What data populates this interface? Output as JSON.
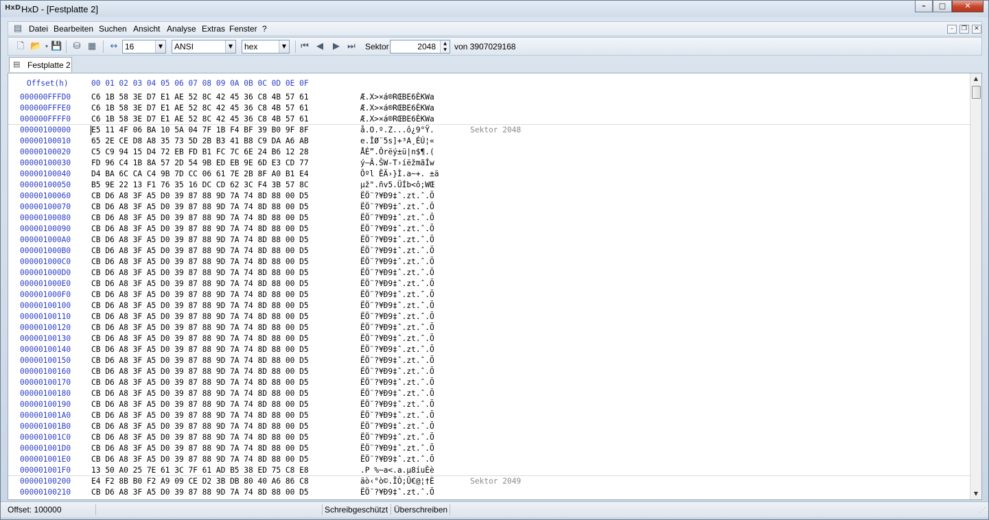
{
  "window": {
    "app_icon": "HxD",
    "title": "HxD - [Festplatte 2]",
    "caption": {
      "minimize": "–",
      "maximize": "□",
      "close": "✕"
    }
  },
  "menu": {
    "items": [
      "Datei",
      "Bearbeiten",
      "Suchen",
      "Ansicht",
      "Analyse",
      "Extras",
      "Fenster",
      "?"
    ],
    "mdi": {
      "minimize": "–",
      "restore": "❐",
      "close": "✕"
    }
  },
  "toolbar": {
    "icons": {
      "new": "new-file-icon",
      "open": "open-folder-icon",
      "save": "save-disk-icon",
      "disk": "open-disk-icon",
      "ram": "open-ram-icon",
      "bytes_per_row": "bytes-per-row-icon"
    },
    "bytes_per_row": "16",
    "charset": "ANSI",
    "offset_base": "hex",
    "sector_label": "Sektor",
    "sector_value": "2048",
    "sector_total": "von 3907029168"
  },
  "tab": {
    "label": "Festplatte 2"
  },
  "editor": {
    "header_offset": "Offset(h)",
    "header_hex": "00 01 02 03 04 05 06 07 08 09 0A 0B 0C 0D 0E 0F",
    "rows": [
      {
        "offset": "000000FFFD0",
        "hex": "C6 1B 58 3E D7 E1 AE 52 8C 42 45 36 C8 4B 57 61",
        "ascii": "Æ.X>×á®RŒBE6ÈKWa",
        "sector": ""
      },
      {
        "offset": "000000FFFE0",
        "hex": "C6 1B 58 3E D7 E1 AE 52 8C 42 45 36 C8 4B 57 61",
        "ascii": "Æ.X>×á®RŒBE6ÈKWa",
        "sector": ""
      },
      {
        "offset": "000000FFFF0",
        "hex": "C6 1B 58 3E D7 E1 AE 52 8C 42 45 36 C8 4B 57 61",
        "ascii": "Æ.X>×á®RŒBE6ÈKWa",
        "sector": ""
      },
      {
        "offset": "00000100000",
        "hex": "E5 11 4F 06 BA 10 5A 04 7F 1B F4 BF 39 B0 9F 8F",
        "ascii": "å.O.º.Z...ô¿9°Ÿ.",
        "sector": "Sektor 2048"
      },
      {
        "offset": "00000100010",
        "hex": "65 2E CE D8 A8 35 73 5D 2B B3 41 B8 C9 DA A6 AB",
        "ascii": "e.ÎØ¨5s]+³A¸ÉÚ¦«",
        "sector": ""
      },
      {
        "offset": "00000100020",
        "hex": "C5 C9 94 15 D4 72 EB FD B1 FC 7C 6E 24 B6 12 28",
        "ascii": "ÅÉ”.Ôrëý±ü|n$¶.(",
        "sector": ""
      },
      {
        "offset": "00000100030",
        "hex": "FD 96 C4 1B 8A 57 2D 54 9B ED EB 9E 6D E3 CD 77",
        "ascii": "ý–Ä.ŠW-T›íëžmãÍw",
        "sector": ""
      },
      {
        "offset": "00000100040",
        "hex": "D4 BA 6C CA C4 9B 7D CC 06 61 7E 2B 8F A0 B1 E4",
        "ascii": "Ôºl ÊÄ›}Ì.a~+. ±ä",
        "sector": ""
      },
      {
        "offset": "00000100050",
        "hex": "B5 9E 22 13 F1 76 35 16 DC CD 62 3C F4 3B 57 8C",
        "ascii": "µž\".ñv5.ÜÍb<ô;WŒ",
        "sector": ""
      },
      {
        "offset": "00000100060",
        "hex": "CB D6 A8 3F A5 D0 39 87 88 9D 7A 74 8D 88 00 D5",
        "ascii": "ËÖ¨?¥Ð9‡ˆ.zt.ˆ.Õ",
        "sector": ""
      },
      {
        "offset": "00000100070",
        "hex": "CB D6 A8 3F A5 D0 39 87 88 9D 7A 74 8D 88 00 D5",
        "ascii": "ËÖ¨?¥Ð9‡ˆ.zt.ˆ.Õ",
        "sector": ""
      },
      {
        "offset": "00000100080",
        "hex": "CB D6 A8 3F A5 D0 39 87 88 9D 7A 74 8D 88 00 D5",
        "ascii": "ËÖ¨?¥Ð9‡ˆ.zt.ˆ.Õ",
        "sector": ""
      },
      {
        "offset": "00000100090",
        "hex": "CB D6 A8 3F A5 D0 39 87 88 9D 7A 74 8D 88 00 D5",
        "ascii": "ËÖ¨?¥Ð9‡ˆ.zt.ˆ.Õ",
        "sector": ""
      },
      {
        "offset": "000001000A0",
        "hex": "CB D6 A8 3F A5 D0 39 87 88 9D 7A 74 8D 88 00 D5",
        "ascii": "ËÖ¨?¥Ð9‡ˆ.zt.ˆ.Õ",
        "sector": ""
      },
      {
        "offset": "000001000B0",
        "hex": "CB D6 A8 3F A5 D0 39 87 88 9D 7A 74 8D 88 00 D5",
        "ascii": "ËÖ¨?¥Ð9‡ˆ.zt.ˆ.Õ",
        "sector": ""
      },
      {
        "offset": "000001000C0",
        "hex": "CB D6 A8 3F A5 D0 39 87 88 9D 7A 74 8D 88 00 D5",
        "ascii": "ËÖ¨?¥Ð9‡ˆ.zt.ˆ.Õ",
        "sector": ""
      },
      {
        "offset": "000001000D0",
        "hex": "CB D6 A8 3F A5 D0 39 87 88 9D 7A 74 8D 88 00 D5",
        "ascii": "ËÖ¨?¥Ð9‡ˆ.zt.ˆ.Õ",
        "sector": ""
      },
      {
        "offset": "000001000E0",
        "hex": "CB D6 A8 3F A5 D0 39 87 88 9D 7A 74 8D 88 00 D5",
        "ascii": "ËÖ¨?¥Ð9‡ˆ.zt.ˆ.Õ",
        "sector": ""
      },
      {
        "offset": "000001000F0",
        "hex": "CB D6 A8 3F A5 D0 39 87 88 9D 7A 74 8D 88 00 D5",
        "ascii": "ËÖ¨?¥Ð9‡ˆ.zt.ˆ.Õ",
        "sector": ""
      },
      {
        "offset": "00000100100",
        "hex": "CB D6 A8 3F A5 D0 39 87 88 9D 7A 74 8D 88 00 D5",
        "ascii": "ËÖ¨?¥Ð9‡ˆ.zt.ˆ.Õ",
        "sector": ""
      },
      {
        "offset": "00000100110",
        "hex": "CB D6 A8 3F A5 D0 39 87 88 9D 7A 74 8D 88 00 D5",
        "ascii": "ËÖ¨?¥Ð9‡ˆ.zt.ˆ.Õ",
        "sector": ""
      },
      {
        "offset": "00000100120",
        "hex": "CB D6 A8 3F A5 D0 39 87 88 9D 7A 74 8D 88 00 D5",
        "ascii": "ËÖ¨?¥Ð9‡ˆ.zt.ˆ.Õ",
        "sector": ""
      },
      {
        "offset": "00000100130",
        "hex": "CB D6 A8 3F A5 D0 39 87 88 9D 7A 74 8D 88 00 D5",
        "ascii": "ËÖ¨?¥Ð9‡ˆ.zt.ˆ.Õ",
        "sector": ""
      },
      {
        "offset": "00000100140",
        "hex": "CB D6 A8 3F A5 D0 39 87 88 9D 7A 74 8D 88 00 D5",
        "ascii": "ËÖ¨?¥Ð9‡ˆ.zt.ˆ.Õ",
        "sector": ""
      },
      {
        "offset": "00000100150",
        "hex": "CB D6 A8 3F A5 D0 39 87 88 9D 7A 74 8D 88 00 D5",
        "ascii": "ËÖ¨?¥Ð9‡ˆ.zt.ˆ.Õ",
        "sector": ""
      },
      {
        "offset": "00000100160",
        "hex": "CB D6 A8 3F A5 D0 39 87 88 9D 7A 74 8D 88 00 D5",
        "ascii": "ËÖ¨?¥Ð9‡ˆ.zt.ˆ.Õ",
        "sector": ""
      },
      {
        "offset": "00000100170",
        "hex": "CB D6 A8 3F A5 D0 39 87 88 9D 7A 74 8D 88 00 D5",
        "ascii": "ËÖ¨?¥Ð9‡ˆ.zt.ˆ.Õ",
        "sector": ""
      },
      {
        "offset": "00000100180",
        "hex": "CB D6 A8 3F A5 D0 39 87 88 9D 7A 74 8D 88 00 D5",
        "ascii": "ËÖ¨?¥Ð9‡ˆ.zt.ˆ.Õ",
        "sector": ""
      },
      {
        "offset": "00000100190",
        "hex": "CB D6 A8 3F A5 D0 39 87 88 9D 7A 74 8D 88 00 D5",
        "ascii": "ËÖ¨?¥Ð9‡ˆ.zt.ˆ.Õ",
        "sector": ""
      },
      {
        "offset": "000001001A0",
        "hex": "CB D6 A8 3F A5 D0 39 87 88 9D 7A 74 8D 88 00 D5",
        "ascii": "ËÖ¨?¥Ð9‡ˆ.zt.ˆ.Õ",
        "sector": ""
      },
      {
        "offset": "000001001B0",
        "hex": "CB D6 A8 3F A5 D0 39 87 88 9D 7A 74 8D 88 00 D5",
        "ascii": "ËÖ¨?¥Ð9‡ˆ.zt.ˆ.Õ",
        "sector": ""
      },
      {
        "offset": "000001001C0",
        "hex": "CB D6 A8 3F A5 D0 39 87 88 9D 7A 74 8D 88 00 D5",
        "ascii": "ËÖ¨?¥Ð9‡ˆ.zt.ˆ.Õ",
        "sector": ""
      },
      {
        "offset": "000001001D0",
        "hex": "CB D6 A8 3F A5 D0 39 87 88 9D 7A 74 8D 88 00 D5",
        "ascii": "ËÖ¨?¥Ð9‡ˆ.zt.ˆ.Õ",
        "sector": ""
      },
      {
        "offset": "000001001E0",
        "hex": "CB D6 A8 3F A5 D0 39 87 88 9D 7A 74 8D 88 00 D5",
        "ascii": "ËÖ¨?¥Ð9‡ˆ.zt.ˆ.Õ",
        "sector": ""
      },
      {
        "offset": "000001001F0",
        "hex": "13 50 A0 25 7E 61 3C 7F 61 AD B5 38 ED 75 C8 E8",
        "ascii": ".P %~a<.a.µ8íuÈè",
        "sector": ""
      },
      {
        "offset": "00000100200",
        "hex": "E4 F2 8B B0 F2 A9 09 CE D2 3B DB 80 40 A6 86 C8",
        "ascii": "äò‹°ò©.ÎÒ;Û€@¦†È",
        "sector": "Sektor 2049"
      },
      {
        "offset": "00000100210",
        "hex": "CB D6 A8 3F A5 D0 39 87 88 9D 7A 74 8D 88 00 D5",
        "ascii": "ËÖ¨?¥Ð9‡ˆ.zt.ˆ.Õ",
        "sector": ""
      }
    ]
  },
  "scrollbar": {
    "up": "▲",
    "down": "▼"
  },
  "status": {
    "offset": "Offset: 100000",
    "readonly": "Schreibgeschützt",
    "mode": "Überschreiben"
  }
}
